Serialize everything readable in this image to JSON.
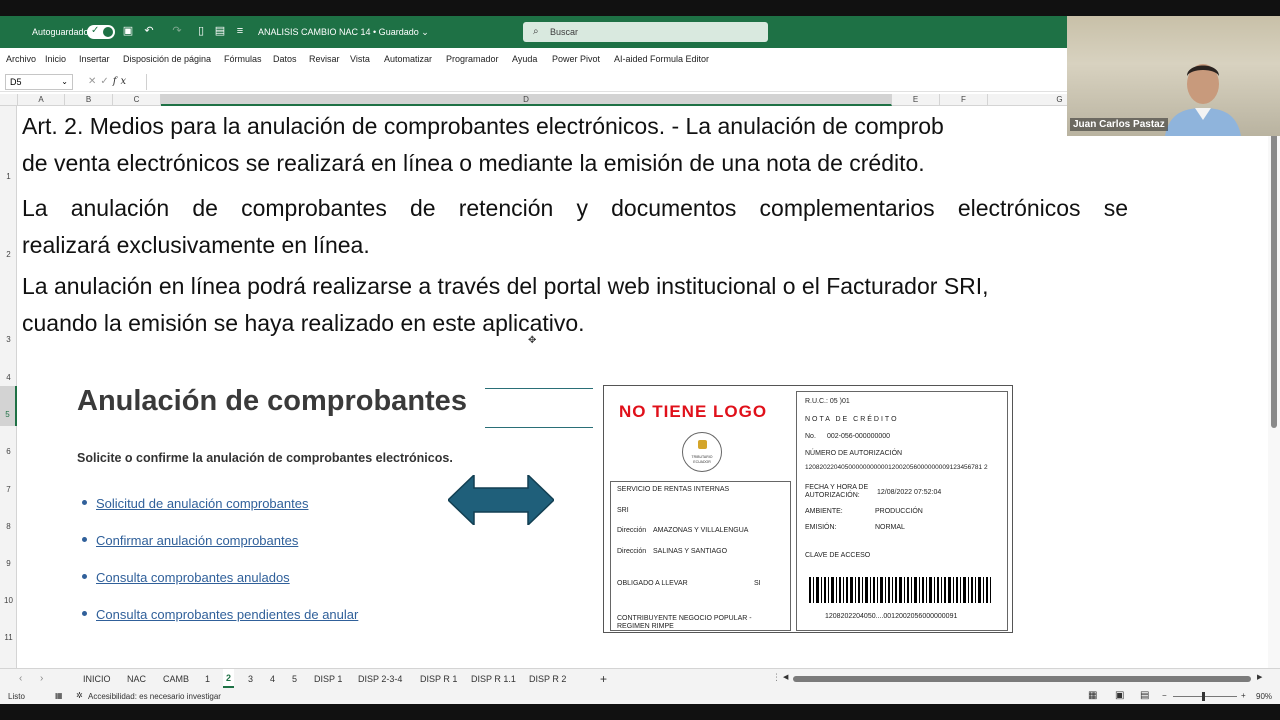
{
  "titlebar": {
    "autosave_label": "Autoguardado",
    "toggle_state": "✓",
    "doc_title": "ANALISIS CAMBIO NAC 14 • Guardado ⌄",
    "search_placeholder": "Buscar"
  },
  "menu": [
    "Archivo",
    "Inicio",
    "Insertar",
    "Disposición de página",
    "Fórmulas",
    "Datos",
    "Revisar",
    "Vista",
    "Automatizar",
    "Programador",
    "Ayuda",
    "Power Pivot",
    "AI-aided Formula Editor"
  ],
  "formula_bar": {
    "name_box": "D5",
    "fx": "fx",
    "value": ""
  },
  "columns": [
    "A",
    "B",
    "C",
    "D",
    "E",
    "F",
    "G"
  ],
  "rows": [
    "1",
    "2",
    "3",
    "4",
    "5",
    "6",
    "7",
    "8",
    "9",
    "10",
    "11"
  ],
  "content": {
    "para1_line1": "Art. 2. Medios para la anulación de comprobantes electrónicos. - La anulación de comprob",
    "para1_line2": "de venta electrónicos se realizará en línea o mediante la emisión de una nota de crédito.",
    "para2_line1": "La anulación de comprobantes de retención y documentos complementarios electrónicos se",
    "para2_line2": "realizará exclusivamente en línea.",
    "para3_line1": "La anulación en línea podrá realizarse a través del portal web institucional o el Facturador SRI,",
    "para3_line2": "cuando la emisión se haya realizado en este aplicativo."
  },
  "section": {
    "title": "Anulación de comprobantes",
    "subtitle": "Solicite o confirme la anulación de comprobantes electrónicos.",
    "links": [
      "Solicitud de anulación comprobantes",
      "Confirmar anulación comprobantes",
      "Consulta comprobantes anulados",
      "Consulta comprobantes pendientes de anular"
    ]
  },
  "invoice": {
    "logo_text": "NO TIENE LOGO",
    "seal_text": "TRIBUTARIO ECUADOR",
    "ruc": "R.U.C.:          05          )01",
    "doc_type": "NOTA DE CRÉDITO",
    "no_label": "No.",
    "no_value": "002-056-000000000",
    "auth_label": "NÚMERO DE AUTORIZACIÓN",
    "auth_value": "1208202204050000000000012002056000000009123456781 2",
    "fecha_label": "FECHA Y HORA DE",
    "fecha_label2": "AUTORIZACIÓN:",
    "fecha_value": "12/08/2022 07:52:04",
    "ambiente_label": "AMBIENTE:",
    "ambiente_value": "PRODUCCIÓN",
    "emision_label": "EMISIÓN:",
    "emision_value": "NORMAL",
    "clave_label": "CLAVE DE ACCESO",
    "barcode_num": "1208202204050....0012002056000000091",
    "emisor": "SERVICIO DE RENTAS INTERNAS",
    "sri": "SRI",
    "dir_label": "Dirección",
    "dir1": "AMAZONAS Y VILLALENGUA",
    "dir2": "SALINAS Y SANTIAGO",
    "obligado": "OBLIGADO A LLEVAR",
    "obligado_value": "SI",
    "regimen1": "CONTRIBUYENTE NEGOCIO POPULAR -",
    "regimen2": "REGIMEN RIMPE"
  },
  "sheet_tabs": [
    "INICIO",
    "NAC",
    "CAMB",
    "1",
    "2",
    "3",
    "4",
    "5",
    "DISP 1",
    "DISP 2-3-4",
    "DISP R 1",
    "DISP R 1.1",
    "DISP R 2"
  ],
  "active_tab": "2",
  "status": {
    "ready": "Listo",
    "accessibility": "Accesibilidad: es necesario investigar",
    "zoom": "90%"
  },
  "webcam": {
    "name": "Juan Carlos Pastaz"
  },
  "colors": {
    "excel_green": "#1e7145",
    "link_blue": "#30609a",
    "arrow_teal": "#1f5f7a",
    "logo_red": "#e0101a"
  }
}
